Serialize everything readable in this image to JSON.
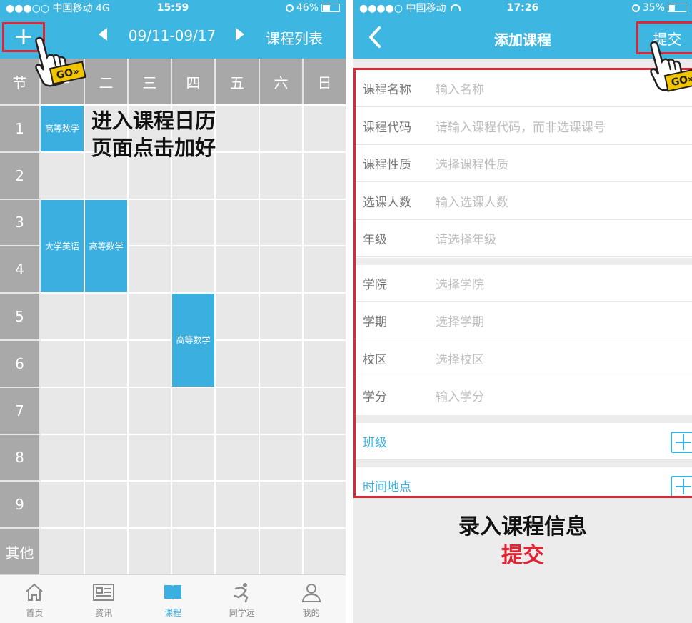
{
  "left": {
    "status": {
      "carrier": "●●●○○ 中国移动  4G",
      "time": "15:59",
      "battery": "46%"
    },
    "nav": {
      "add_icon": "plus-icon",
      "week_range": "09/11-09/17",
      "course_list": "课程列表"
    },
    "grid": {
      "corner": "节",
      "days": [
        "一",
        "二",
        "三",
        "四",
        "五",
        "六",
        "日"
      ],
      "periods": [
        "1",
        "2",
        "3",
        "4",
        "5",
        "6",
        "7",
        "8",
        "9",
        "其他"
      ],
      "courses": [
        {
          "name": "高等数学",
          "day": 1,
          "start": 1,
          "span": 1
        },
        {
          "name": "大学英语",
          "day": 1,
          "start": 3,
          "span": 2
        },
        {
          "name": "高等数学",
          "day": 2,
          "start": 3,
          "span": 2
        },
        {
          "name": "高等数学",
          "day": 4,
          "start": 5,
          "span": 2
        }
      ]
    },
    "annotation": [
      "进入课程日历",
      "页面点击加好"
    ],
    "tabs": [
      {
        "label": "首页",
        "icon": "home-icon",
        "active": false
      },
      {
        "label": "资讯",
        "icon": "news-icon",
        "active": false
      },
      {
        "label": "课程",
        "icon": "book-icon",
        "active": true
      },
      {
        "label": "同学远",
        "icon": "runner-icon",
        "active": false
      },
      {
        "label": "我的",
        "icon": "user-icon",
        "active": false
      }
    ],
    "hand_badge": "GO»"
  },
  "right": {
    "status": {
      "carrier": "●●●●○ 中国移动",
      "time": "17:26",
      "battery": "35%"
    },
    "nav": {
      "back_icon": "chevron-left-icon",
      "title": "添加课程",
      "submit": "提交"
    },
    "form": {
      "group1": [
        {
          "label": "课程名称",
          "placeholder": "输入名称"
        },
        {
          "label": "课程代码",
          "placeholder": "请输入课程代码，而非选课课号"
        },
        {
          "label": "课程性质",
          "placeholder": "选择课程性质"
        },
        {
          "label": "选课人数",
          "placeholder": "输入选课人数"
        },
        {
          "label": "年级",
          "placeholder": "请选择年级"
        }
      ],
      "group2": [
        {
          "label": "学院",
          "placeholder": "选择学院"
        },
        {
          "label": "学期",
          "placeholder": "选择学期"
        },
        {
          "label": "校区",
          "placeholder": "选择校区"
        },
        {
          "label": "学分",
          "placeholder": "输入学分"
        }
      ],
      "class_label": "班级",
      "time_place_label": "时间地点"
    },
    "annotation": {
      "line1": "录入课程信息",
      "line2": "提交"
    },
    "hand_badge": "GO»"
  },
  "colors": {
    "accent": "#3db6e2",
    "highlight": "#e02534",
    "course": "#3bb0e0"
  }
}
